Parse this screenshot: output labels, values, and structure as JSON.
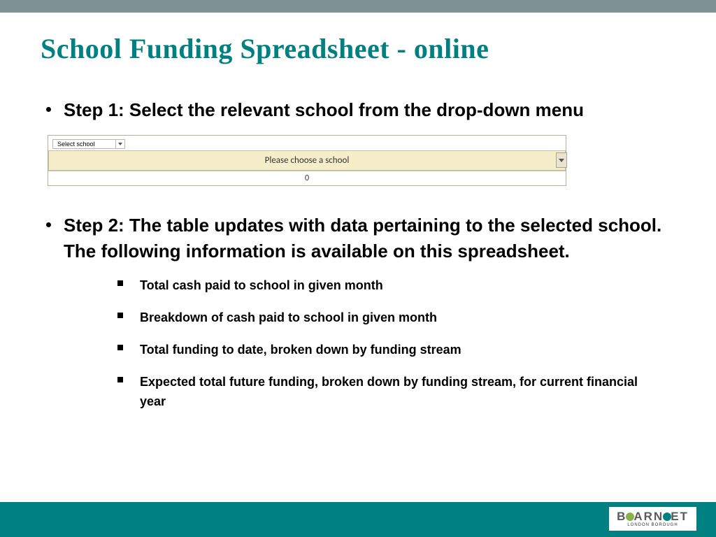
{
  "title": "School Funding Spreadsheet - online",
  "steps": [
    "Step 1: Select the relevant school from the drop-down menu",
    "Step 2: The table updates with data pertaining to the selected school. The following information is available on this spreadsheet."
  ],
  "spreadsheet": {
    "dropdown_label": "Select school",
    "choose_prompt": "Please choose a school",
    "value_row": "0"
  },
  "sub_points": [
    "Total cash paid to school in given month",
    "Breakdown of cash paid to school in given month",
    "Total funding to date, broken down by funding stream",
    "Expected total future funding, broken down by funding stream, for current financial year"
  ],
  "logo": {
    "text": "BARNET",
    "subtitle": "LONDON BOROUGH"
  }
}
